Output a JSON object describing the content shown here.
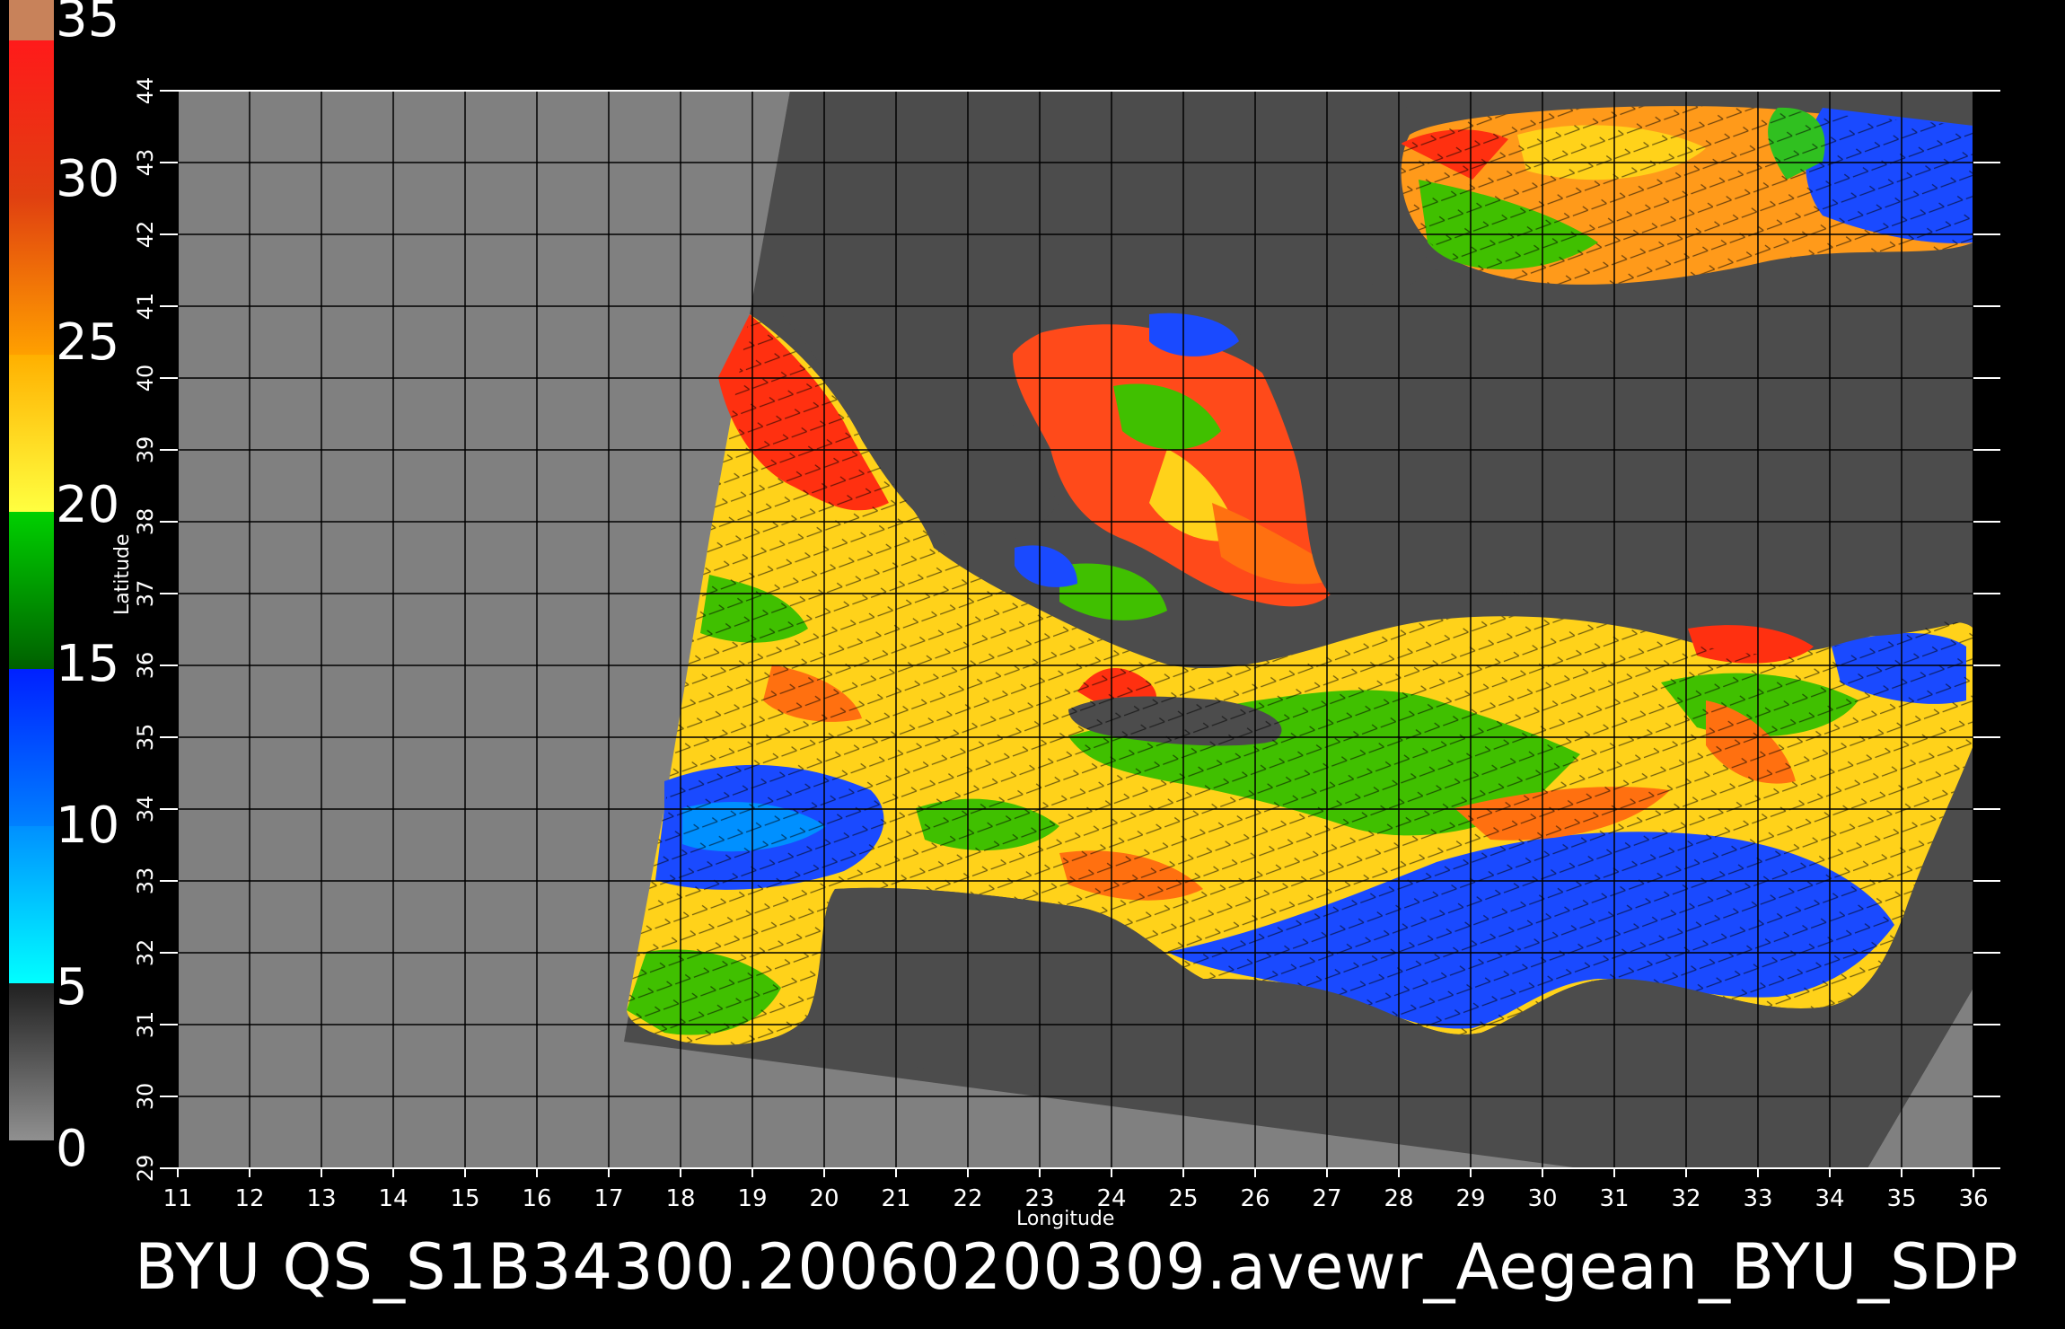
{
  "colorbar": {
    "labels": [
      "35",
      "30",
      "25",
      "20",
      "15",
      "10",
      "5",
      "0"
    ],
    "stops": [
      {
        "value": 35,
        "color": "#c8825a"
      },
      {
        "value": 33,
        "color": "#ff1a1a"
      },
      {
        "value": 30,
        "color": "#e8401a"
      },
      {
        "value": 27,
        "color": "#ff8000"
      },
      {
        "value": 24,
        "color": "#ffc800"
      },
      {
        "value": 20,
        "color": "#ffff33"
      },
      {
        "value": 19,
        "color": "#00c800"
      },
      {
        "value": 15,
        "color": "#006400"
      },
      {
        "value": 14.9,
        "color": "#0030ff"
      },
      {
        "value": 10,
        "color": "#0080ff"
      },
      {
        "value": 5.1,
        "color": "#00ffff"
      },
      {
        "value": 5,
        "color": "#202020"
      },
      {
        "value": 0,
        "color": "#808080"
      }
    ]
  },
  "axes": {
    "x_label": "Longitude",
    "y_label": "Latitude",
    "x_ticks": [
      "11",
      "12",
      "13",
      "14",
      "15",
      "16",
      "17",
      "18",
      "19",
      "20",
      "21",
      "22",
      "23",
      "24",
      "25",
      "26",
      "27",
      "28",
      "29",
      "30",
      "31",
      "32",
      "33",
      "34",
      "35",
      "36"
    ],
    "y_ticks": [
      "29",
      "30",
      "31",
      "32",
      "33",
      "34",
      "35",
      "36",
      "37",
      "38",
      "39",
      "40",
      "41",
      "42",
      "43",
      "44"
    ],
    "xlim": [
      11,
      36
    ],
    "ylim": [
      29,
      44
    ]
  },
  "footer": {
    "text": "BYU  QS_S1B34300.20060200309.avewr_Aegean_BYU_SDP"
  },
  "colors": {
    "background": "#000000",
    "outside_swath": "#808080",
    "land_in_swath": "#505050",
    "grid": "#000000"
  }
}
